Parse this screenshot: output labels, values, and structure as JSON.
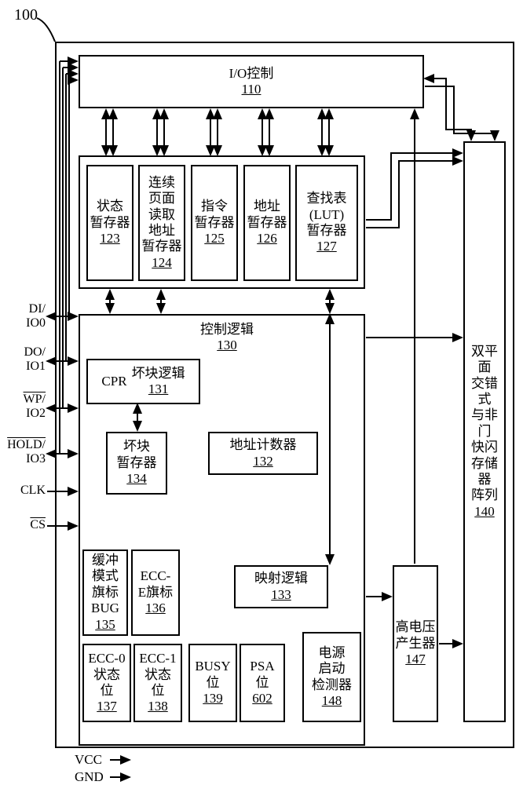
{
  "ref": "100",
  "io_control": {
    "label": "I/O控制",
    "num": "110"
  },
  "registers": {
    "status": {
      "l1": "状态",
      "l2": "暂存器",
      "num": "123"
    },
    "cpr_addr": {
      "l1": "连续",
      "l2": "页面",
      "l3": "读取",
      "l4": "地址",
      "l5": "暂存器",
      "num": "124"
    },
    "instr": {
      "l1": "指令",
      "l2": "暂存器",
      "num": "125"
    },
    "addr": {
      "l1": "地址",
      "l2": "暂存器",
      "num": "126"
    },
    "lut": {
      "l1": "查找表",
      "l2": "(LUT)",
      "l3": "暂存器",
      "num": "127"
    }
  },
  "control_logic": {
    "label": "控制逻辑",
    "num": "130"
  },
  "cpr_bad": {
    "l1": "CPR",
    "l2": "坏块逻辑",
    "num": "131"
  },
  "addr_counter": {
    "label": "地址计数器",
    "num": "132"
  },
  "bad_reg": {
    "l1": "坏块",
    "l2": "暂存器",
    "num": "134"
  },
  "map_logic": {
    "label": "映射逻辑",
    "num": "133"
  },
  "bug": {
    "l1": "缓冲",
    "l2": "模式",
    "l3": "旗标",
    "l4": "BUG",
    "num": "135"
  },
  "ecce": {
    "l1": "ECC-",
    "l2": "E旗标",
    "num": "136"
  },
  "ecc0": {
    "l1": "ECC-0",
    "l2": "状态",
    "l3": "位",
    "num": "137"
  },
  "ecc1": {
    "l1": "ECC-1",
    "l2": "状态",
    "l3": "位",
    "num": "138"
  },
  "busy": {
    "l1": "BUSY",
    "l2": "位",
    "num": "139"
  },
  "psa": {
    "l1": "PSA",
    "l2": "位",
    "num": "602"
  },
  "psd": {
    "l1": "电源",
    "l2": "启动",
    "l3": "检测器",
    "num": "148"
  },
  "hv": {
    "l1": "高电压",
    "l2": "产生器",
    "num": "147"
  },
  "array": {
    "l1": "双平面",
    "l2": "交错式",
    "l3": "与非门",
    "l4": "快闪",
    "l5": "存储器",
    "l6": "阵列",
    "num": "140"
  },
  "pins": {
    "di": "DI/",
    "di2": "IO0",
    "do": "DO/",
    "do2": "IO1",
    "wp": "WP/",
    "wp2": "IO2",
    "hold": "HOLD/",
    "hold2": "IO3",
    "clk": "CLK",
    "cs": "CS",
    "vcc": "VCC",
    "gnd": "GND"
  }
}
